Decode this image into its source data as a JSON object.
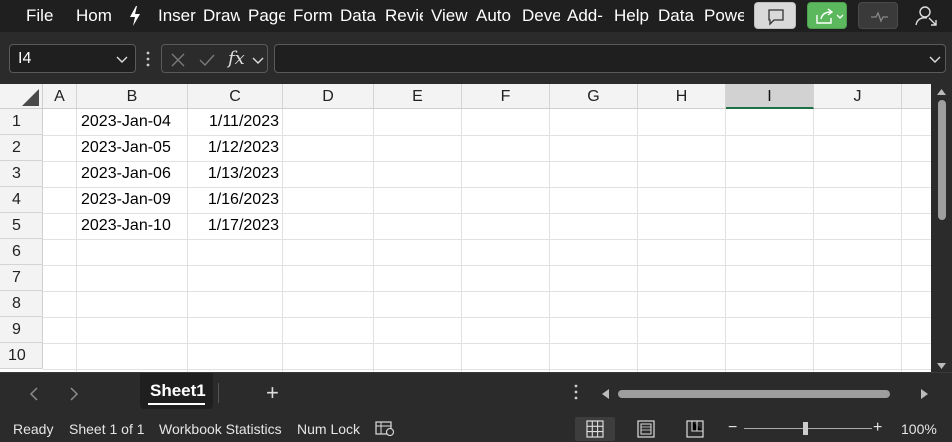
{
  "ribbon": {
    "tabs": [
      "File",
      "Hom",
      "Inser",
      "Draw",
      "Page",
      "Form",
      "Data",
      "Revie",
      "View",
      "Auto",
      "Deve",
      "Add-",
      "Help",
      "Data",
      "Powe"
    ]
  },
  "formula_bar": {
    "name_box": "I4",
    "fx_label": "fx",
    "formula": ""
  },
  "grid": {
    "columns": [
      "A",
      "B",
      "C",
      "D",
      "E",
      "F",
      "G",
      "H",
      "I",
      "J"
    ],
    "selected_column": "I",
    "rows": [
      "1",
      "2",
      "3",
      "4",
      "5",
      "6",
      "7",
      "8",
      "9",
      "10"
    ],
    "data": [
      {
        "b": "2023-Jan-04",
        "c": "1/11/2023"
      },
      {
        "b": "2023-Jan-05",
        "c": "1/12/2023"
      },
      {
        "b": "2023-Jan-06",
        "c": "1/13/2023"
      },
      {
        "b": "2023-Jan-09",
        "c": "1/16/2023"
      },
      {
        "b": "2023-Jan-10",
        "c": "1/17/2023"
      }
    ]
  },
  "sheets": {
    "tabs": [
      "Sheet1"
    ],
    "active": "Sheet1",
    "add_label": "+"
  },
  "status": {
    "ready": "Ready",
    "sheet_info": "Sheet 1 of 1",
    "workbook_stats": "Workbook Statistics",
    "num_lock": "Num Lock",
    "zoom_minus": "−",
    "zoom_plus": "+",
    "zoom": "100%"
  },
  "colors": {
    "accent_green": "#5cb85c",
    "selected_header_border": "#1e7145"
  }
}
